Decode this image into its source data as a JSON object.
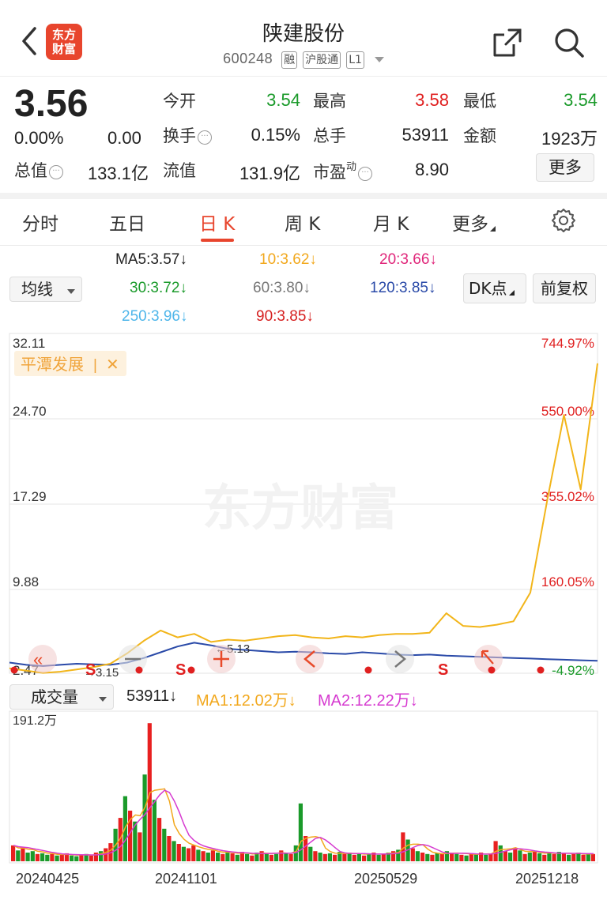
{
  "header": {
    "logo_line1": "东方",
    "logo_line2": "财富",
    "name": "陕建股份",
    "code": "600248",
    "tags": [
      "融",
      "沪股通",
      "L1"
    ]
  },
  "quote": {
    "price": "3.56",
    "change_pct": "0.00%",
    "change_amt": "0.00",
    "open_label": "今开",
    "open": "3.54",
    "high_label": "最高",
    "high": "3.58",
    "low_label": "最低",
    "low": "3.54",
    "turnover_label": "换手",
    "turnover": "0.15%",
    "volume_label": "总手",
    "volume": "53911",
    "amount_label": "金额",
    "amount": "1923万",
    "mcap_label": "总值",
    "mcap": "133.1亿",
    "float_label": "流值",
    "float_mcap": "131.9亿",
    "pe_label": "市盈",
    "pe_sup": "动",
    "pe": "8.90",
    "more_label": "更多",
    "colors": {
      "up": "#e02020",
      "down": "#1a9a2a"
    }
  },
  "tabs": [
    {
      "label": "分时",
      "active": false
    },
    {
      "label": "五日",
      "active": false
    },
    {
      "label": "日 K",
      "active": true
    },
    {
      "label": "周 K",
      "active": false
    },
    {
      "label": "月 K",
      "active": false
    },
    {
      "label": "更多",
      "active": false
    }
  ],
  "ma": {
    "selector_label": "均线",
    "ma5": "MA5:3.57↓",
    "ma10": "10:3.62↓",
    "ma20": "20:3.66↓",
    "ma30": "30:3.72↓",
    "ma60": "60:3.80↓",
    "ma120": "120:3.85↓",
    "ma250": "250:3.96↓",
    "ma90": "90:3.85↓",
    "dk_label": "DK点",
    "adjust_label": "前复权",
    "colors": {
      "ma5": "#222222",
      "ma10": "#f2a81d",
      "ma20": "#e0267a",
      "ma30": "#1a9a2a",
      "ma60": "#777777",
      "ma120": "#2a4aa8",
      "ma250": "#4fb6ea",
      "ma90": "#d62020"
    }
  },
  "main_chart": {
    "y_left_ticks": [
      "32.11",
      "24.70",
      "17.29",
      "9.88",
      "2.47"
    ],
    "y_right_ticks": [
      "744.97%",
      "550.00%",
      "355.02%",
      "160.05%",
      "-4.92%"
    ],
    "compare_label": "平潭发展",
    "compare_close": "✕",
    "watermark": "东方财富",
    "annot_high": "5.13",
    "annot_low": "3.15",
    "markers": [
      "S",
      "S",
      "S"
    ]
  },
  "volume": {
    "selector_label": "成交量",
    "value": "53911↓",
    "ma1": "MA1:12.02万↓",
    "ma2": "MA2:12.22万↓",
    "y_top": "191.2万",
    "dates": [
      "20240425",
      "20241101",
      "20250529",
      "20251218"
    ]
  },
  "chart_data": {
    "type": "line",
    "title": "",
    "xlabel": "",
    "ylabel": "",
    "ylim": [
      2.47,
      32.11
    ],
    "x": [
      "20240425",
      "20241101",
      "20250529",
      "20251218"
    ],
    "series": [
      {
        "name": "陕建股份",
        "color": "#2a4aa8",
        "values": [
          3.4,
          3.2,
          3.1,
          3.2,
          3.3,
          3.25,
          3.2,
          3.4,
          3.8,
          4.3,
          4.8,
          5.13,
          4.9,
          4.6,
          4.5,
          4.4,
          4.3,
          4.35,
          4.3,
          4.2,
          4.15,
          4.3,
          4.2,
          4.1,
          4.05,
          4.1,
          4.0,
          3.95,
          3.9,
          3.85,
          3.8,
          3.75,
          3.7,
          3.65,
          3.6,
          3.56
        ]
      },
      {
        "name": "平潭发展",
        "color": "#f2b51a",
        "values": [
          2.9,
          2.7,
          2.5,
          2.6,
          2.8,
          3.0,
          3.3,
          4.2,
          5.3,
          6.2,
          5.6,
          5.9,
          5.2,
          5.4,
          5.3,
          5.5,
          5.7,
          5.8,
          5.6,
          5.5,
          5.7,
          5.6,
          5.8,
          5.9,
          5.9,
          6.0,
          7.7,
          6.6,
          6.5,
          6.7,
          7.0,
          9.5,
          17.5,
          25.0,
          18.5,
          29.5
        ]
      }
    ]
  },
  "vol_data": {
    "max": 191.2,
    "bars": [
      22,
      15,
      18,
      12,
      14,
      10,
      11,
      9,
      10,
      8,
      9,
      11,
      8,
      7,
      9,
      10,
      8,
      12,
      14,
      18,
      25,
      45,
      60,
      90,
      70,
      55,
      40,
      120,
      191,
      85,
      60,
      45,
      35,
      28,
      24,
      20,
      18,
      22,
      16,
      14,
      12,
      15,
      12,
      10,
      14,
      11,
      9,
      13,
      10,
      8,
      12,
      14,
      11,
      9,
      10,
      15,
      12,
      10,
      22,
      80,
      35,
      20,
      14,
      12,
      10,
      11,
      9,
      13,
      10,
      12,
      9,
      10,
      8,
      11,
      12,
      9,
      10,
      12,
      14,
      16,
      40,
      30,
      18,
      14,
      12,
      10,
      9,
      11,
      10,
      14,
      12,
      10,
      9,
      8,
      11,
      10,
      12,
      9,
      10,
      28,
      22,
      14,
      12,
      18,
      15,
      10,
      12,
      14,
      11,
      9,
      12,
      10,
      13,
      11,
      9,
      10,
      12,
      9,
      11,
      10
    ],
    "colors": [
      "r",
      "g",
      "r",
      "g",
      "g",
      "r",
      "g",
      "g",
      "r",
      "g",
      "r",
      "r",
      "g",
      "g",
      "r",
      "g",
      "r",
      "r",
      "g",
      "r",
      "r",
      "g",
      "r",
      "g",
      "r",
      "g",
      "r",
      "g",
      "r",
      "g",
      "r",
      "g",
      "r",
      "g",
      "r",
      "g",
      "r",
      "r",
      "g",
      "r",
      "g",
      "r",
      "g",
      "r",
      "g",
      "r",
      "g",
      "r",
      "g",
      "r",
      "g",
      "r",
      "g",
      "r",
      "g",
      "r",
      "g",
      "r",
      "g",
      "g",
      "r",
      "g",
      "r",
      "g",
      "r",
      "g",
      "r",
      "g",
      "r",
      "g",
      "r",
      "g",
      "r",
      "g",
      "r",
      "g",
      "r",
      "g",
      "r",
      "g",
      "r",
      "g",
      "r",
      "g",
      "r",
      "g",
      "r",
      "g",
      "r",
      "g",
      "r",
      "g",
      "r",
      "g",
      "r",
      "g",
      "r",
      "g",
      "r",
      "r",
      "g",
      "r",
      "g",
      "r",
      "g",
      "r",
      "g",
      "r",
      "g",
      "r",
      "g",
      "r",
      "g",
      "r",
      "g",
      "r",
      "g",
      "r",
      "g",
      "r"
    ]
  }
}
